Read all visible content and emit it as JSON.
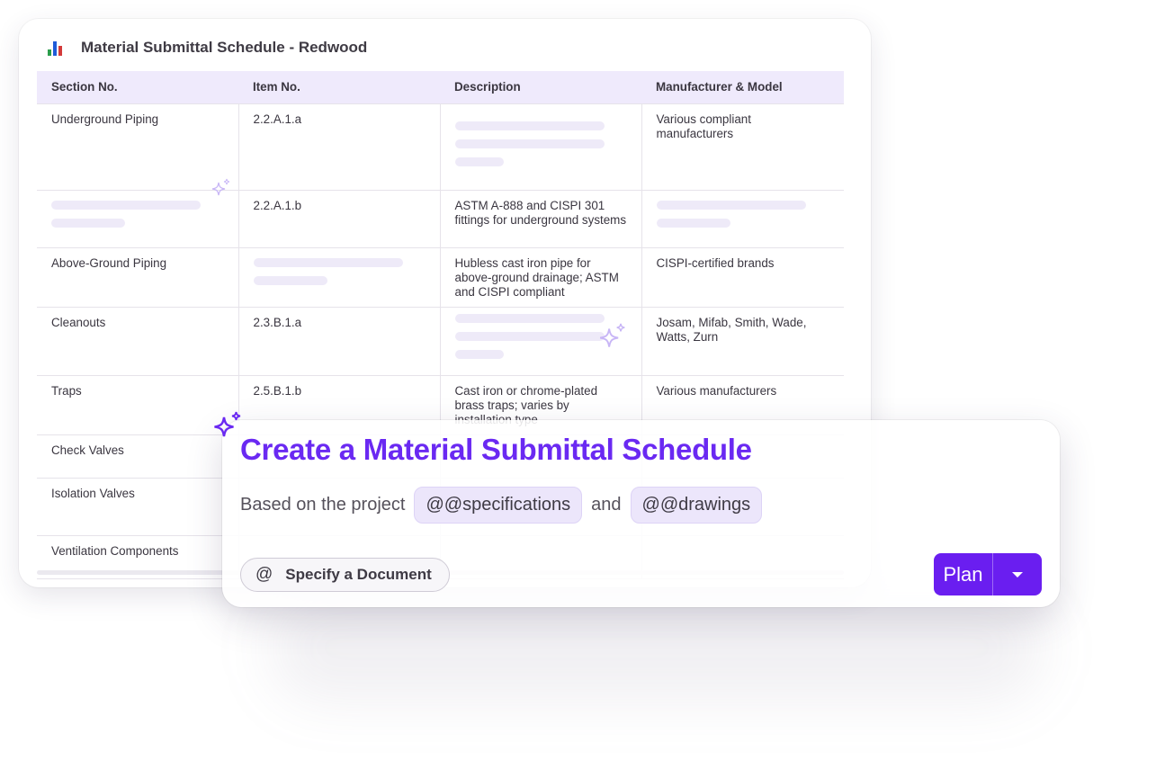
{
  "schedule": {
    "title": "Material Submittal Schedule - Redwood",
    "icon": "bar-chart-icon",
    "columns": [
      "Section No.",
      "Item No.",
      "Description",
      "Manufacturer & Model"
    ],
    "rows": [
      {
        "section": "Underground Piping",
        "item": "2.2.A.1.a",
        "description": "",
        "manufacturer": "Various compliant manufacturers"
      },
      {
        "section": "",
        "item": "2.2.A.1.b",
        "description": "ASTM A-888 and CISPI 301 fittings for underground systems",
        "manufacturer": ""
      },
      {
        "section": "Above-Ground Piping",
        "item": "",
        "description": "Hubless cast iron pipe for above-ground drainage; ASTM and CISPI compliant",
        "manufacturer": "CISPI-certified brands"
      },
      {
        "section": "Cleanouts",
        "item": "2.3.B.1.a",
        "description": "",
        "manufacturer": "Josam, Mifab, Smith, Wade, Watts, Zurn"
      },
      {
        "section": "Traps",
        "item": "2.5.B.1.b",
        "description": "Cast iron or chrome-plated brass traps; varies by installation type",
        "manufacturer": "Various manufacturers"
      },
      {
        "section": "Check Valves",
        "item": "",
        "description": "",
        "manufacturer": ""
      },
      {
        "section": "Isolation Valves",
        "item": "",
        "description": "",
        "manufacturer": ""
      },
      {
        "section": "Ventilation Components",
        "item": "",
        "description": "",
        "manufacturer": ""
      }
    ]
  },
  "prompt": {
    "title": "Create a Material Submittal Schedule",
    "line_prefix": "Based on the project",
    "chip_specifications": "@@specifications",
    "conjunction": "and",
    "chip_drawings": "@@drawings",
    "specify_button": "Specify a Document",
    "specify_icon": "@",
    "plan_button": "Plan",
    "plan_dropdown_icon": "chevron-down-icon"
  },
  "colors": {
    "accent": "#6a29f2",
    "header_bg": "#efeafc",
    "chip_bg": "#ece6fb"
  }
}
